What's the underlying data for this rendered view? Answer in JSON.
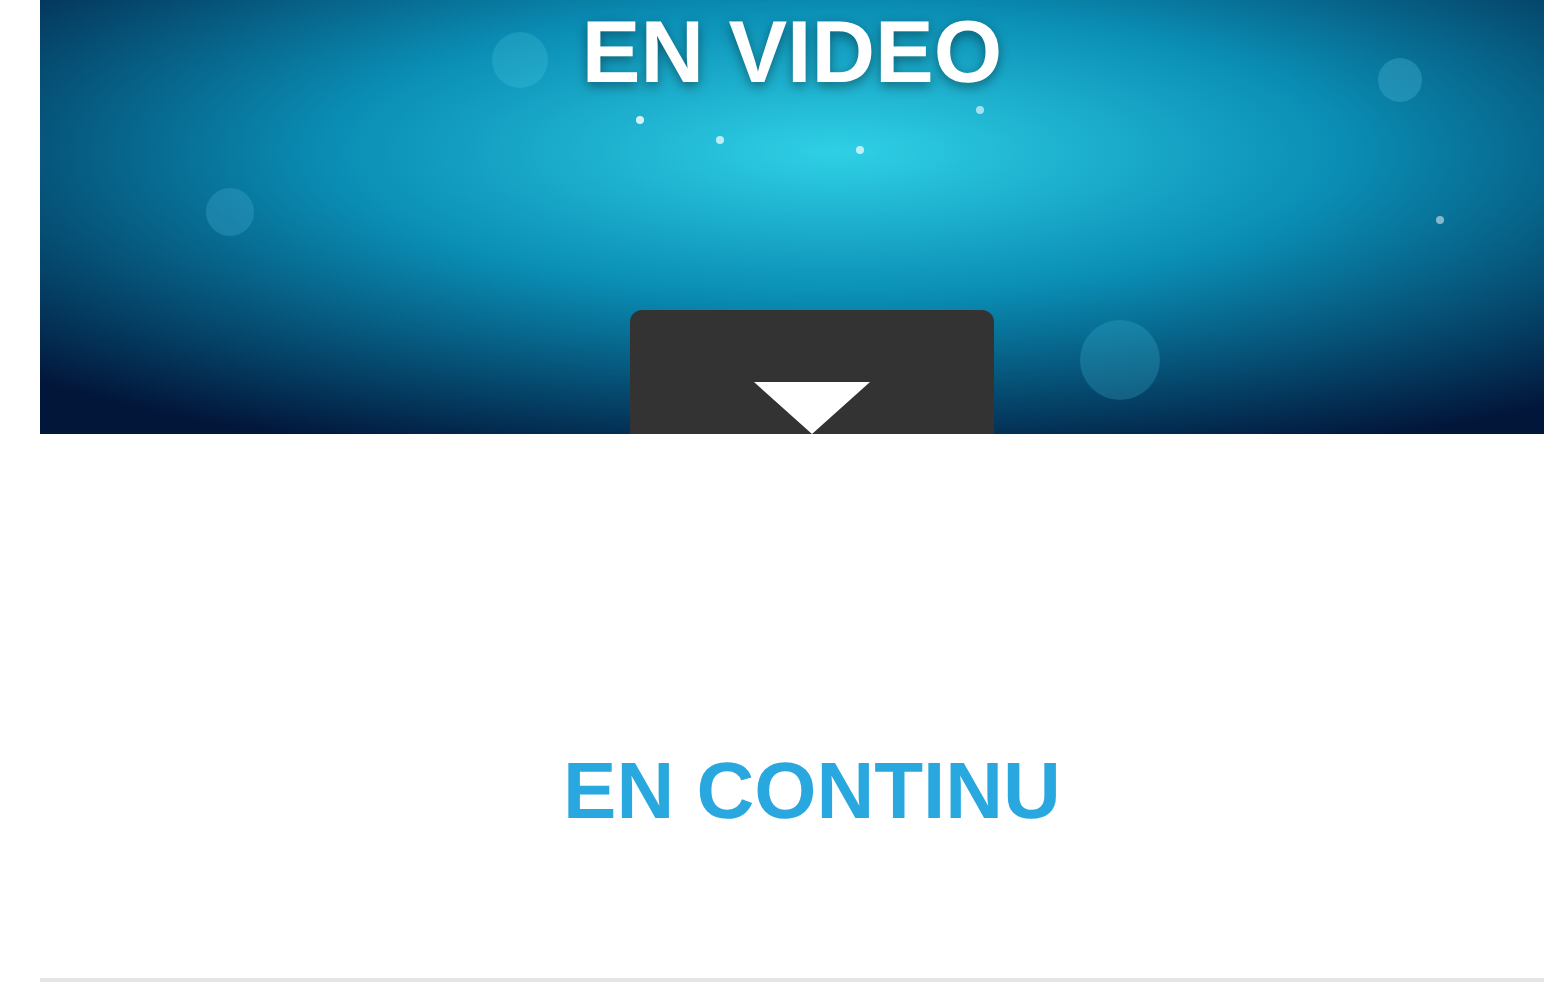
{
  "banner": {
    "title": "EN VIDEO"
  },
  "section": {
    "title": "EN CONTINU"
  }
}
